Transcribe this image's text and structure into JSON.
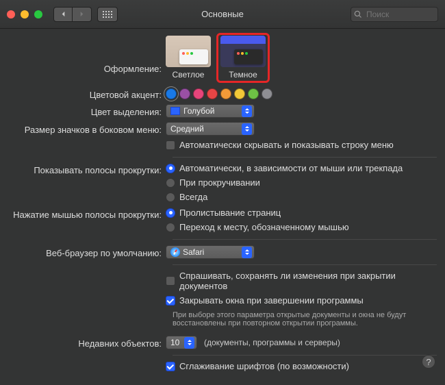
{
  "titlebar": {
    "title": "Основные",
    "searchPlaceholder": "Поиск"
  },
  "appearance": {
    "label": "Оформление:",
    "light": "Светлое",
    "dark": "Темное"
  },
  "accent": {
    "label": "Цветовой акцент:",
    "colors": [
      "#1979e7",
      "#9a50a5",
      "#e7457a",
      "#e74545",
      "#f29a38",
      "#f2c938",
      "#6ec245",
      "#8e8e93"
    ]
  },
  "highlight": {
    "label": "Цвет выделения:",
    "value": "Голубой"
  },
  "sidebarSize": {
    "label": "Размер значков в боковом меню:",
    "value": "Средний"
  },
  "autohide": {
    "label": "Автоматически скрывать и показывать строку меню"
  },
  "scrollbars": {
    "label": "Показывать полосы прокрутки:",
    "opt1": "Автоматически, в зависимости от мыши или трекпада",
    "opt2": "При прокручивании",
    "opt3": "Всегда"
  },
  "scrollclick": {
    "label": "Нажатие мышью полосы прокрутки:",
    "opt1": "Пролистывание страниц",
    "opt2": "Переход к месту, обозначенному мышью"
  },
  "browser": {
    "label": "Веб-браузер по умолчанию:",
    "value": "Safari"
  },
  "docs": {
    "askSave": "Спрашивать, сохранять ли изменения при закрытии документов",
    "closeWin": "Закрывать окна при завершении программы",
    "note": "При выборе этого параметра открытые документы и окна не будут восстановлены при повторном открытии программы."
  },
  "recent": {
    "label": "Недавних объектов:",
    "value": "10",
    "suffix": "(документы, программы и серверы)"
  },
  "smoothing": {
    "label": "Сглаживание шрифтов (по возможности)"
  }
}
